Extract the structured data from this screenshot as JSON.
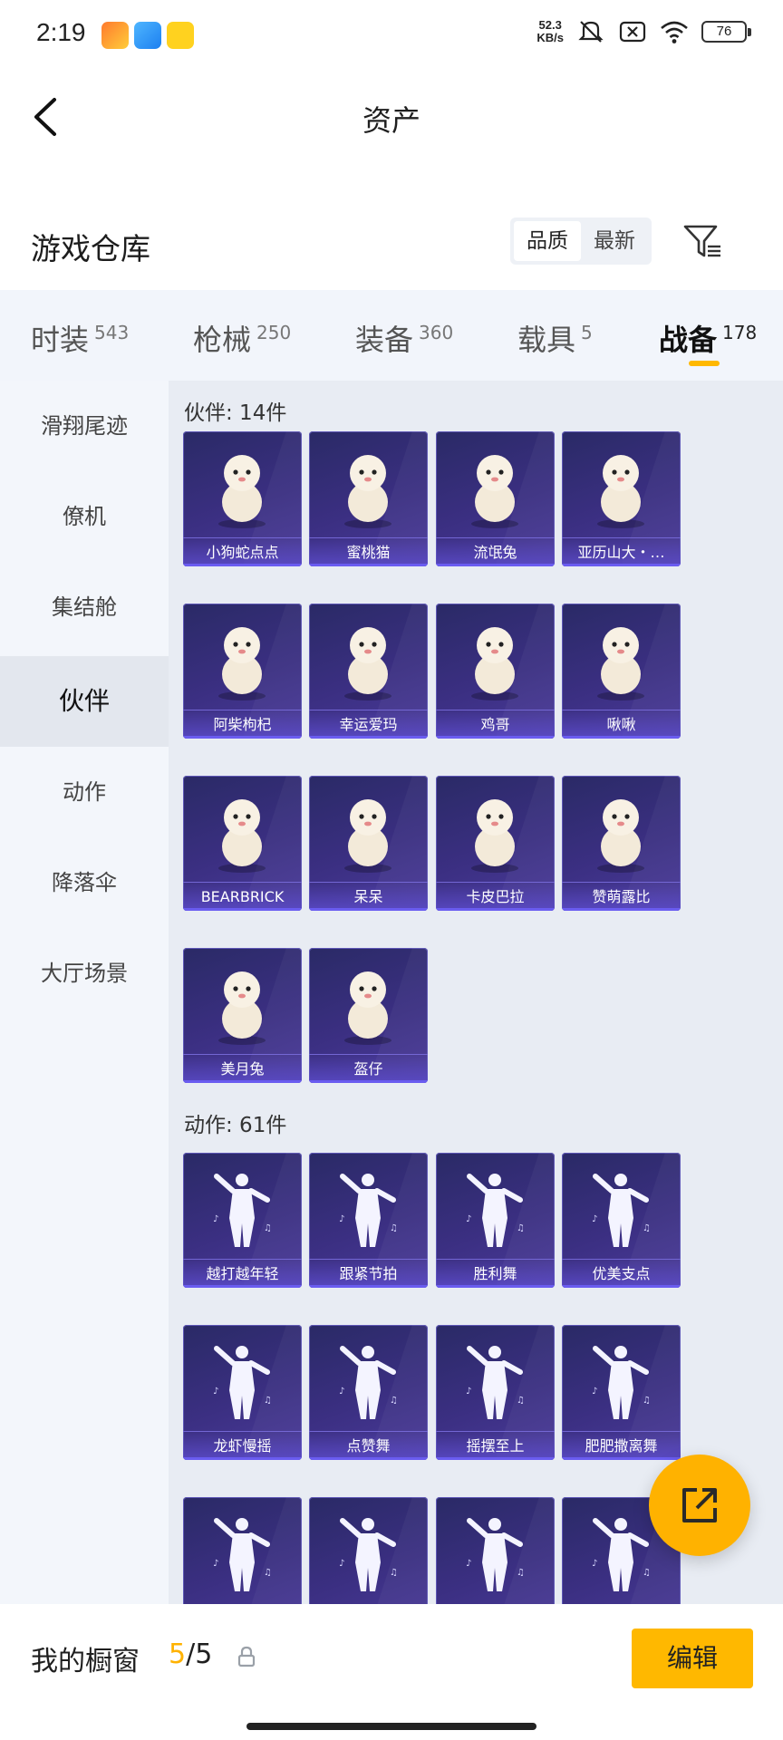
{
  "status_bar": {
    "time": "2:19",
    "speed_value": "52.3",
    "speed_unit": "KB/s",
    "battery": "76"
  },
  "header": {
    "title": "资产"
  },
  "warehouse": {
    "title": "游戏仓库",
    "sort_options": [
      "品质",
      "最新"
    ],
    "active_sort": "品质"
  },
  "tabs": [
    {
      "label": "时装",
      "count": "543"
    },
    {
      "label": "枪械",
      "count": "250"
    },
    {
      "label": "装备",
      "count": "360"
    },
    {
      "label": "载具",
      "count": "5"
    },
    {
      "label": "战备",
      "count": "178",
      "active": true
    }
  ],
  "categories": [
    "滑翔尾迹",
    "僚机",
    "集结舱",
    "伙伴",
    "动作",
    "降落伞",
    "大厅场景"
  ],
  "active_category": "伙伴",
  "partner_group": {
    "title": "伙伴: 14件",
    "items": [
      "小狗蛇点点",
      "蜜桃猫",
      "流氓兔",
      "亚历山大・…",
      "阿柴枸杞",
      "幸运爱玛",
      "鸡哥",
      "啾啾",
      "BEARBRICK",
      "呆呆",
      "卡皮巴拉",
      "赞萌露比",
      "美月兔",
      "盔仔"
    ]
  },
  "action_group": {
    "title": "动作: 61件",
    "items": [
      "越打越年轻",
      "跟紧节拍",
      "胜利舞",
      "优美支点",
      "龙虾慢摇",
      "点赞舞",
      "摇摆至上",
      "肥肥撒离舞",
      "",
      "",
      "",
      ""
    ]
  },
  "bottom": {
    "cabinet_label": "我的橱窗",
    "current": "5",
    "total": "/5",
    "edit_label": "编辑"
  },
  "colors": {
    "accent": "#ffb800",
    "card_bg": "#3b2f82",
    "card_label": "#5a4ac8"
  }
}
